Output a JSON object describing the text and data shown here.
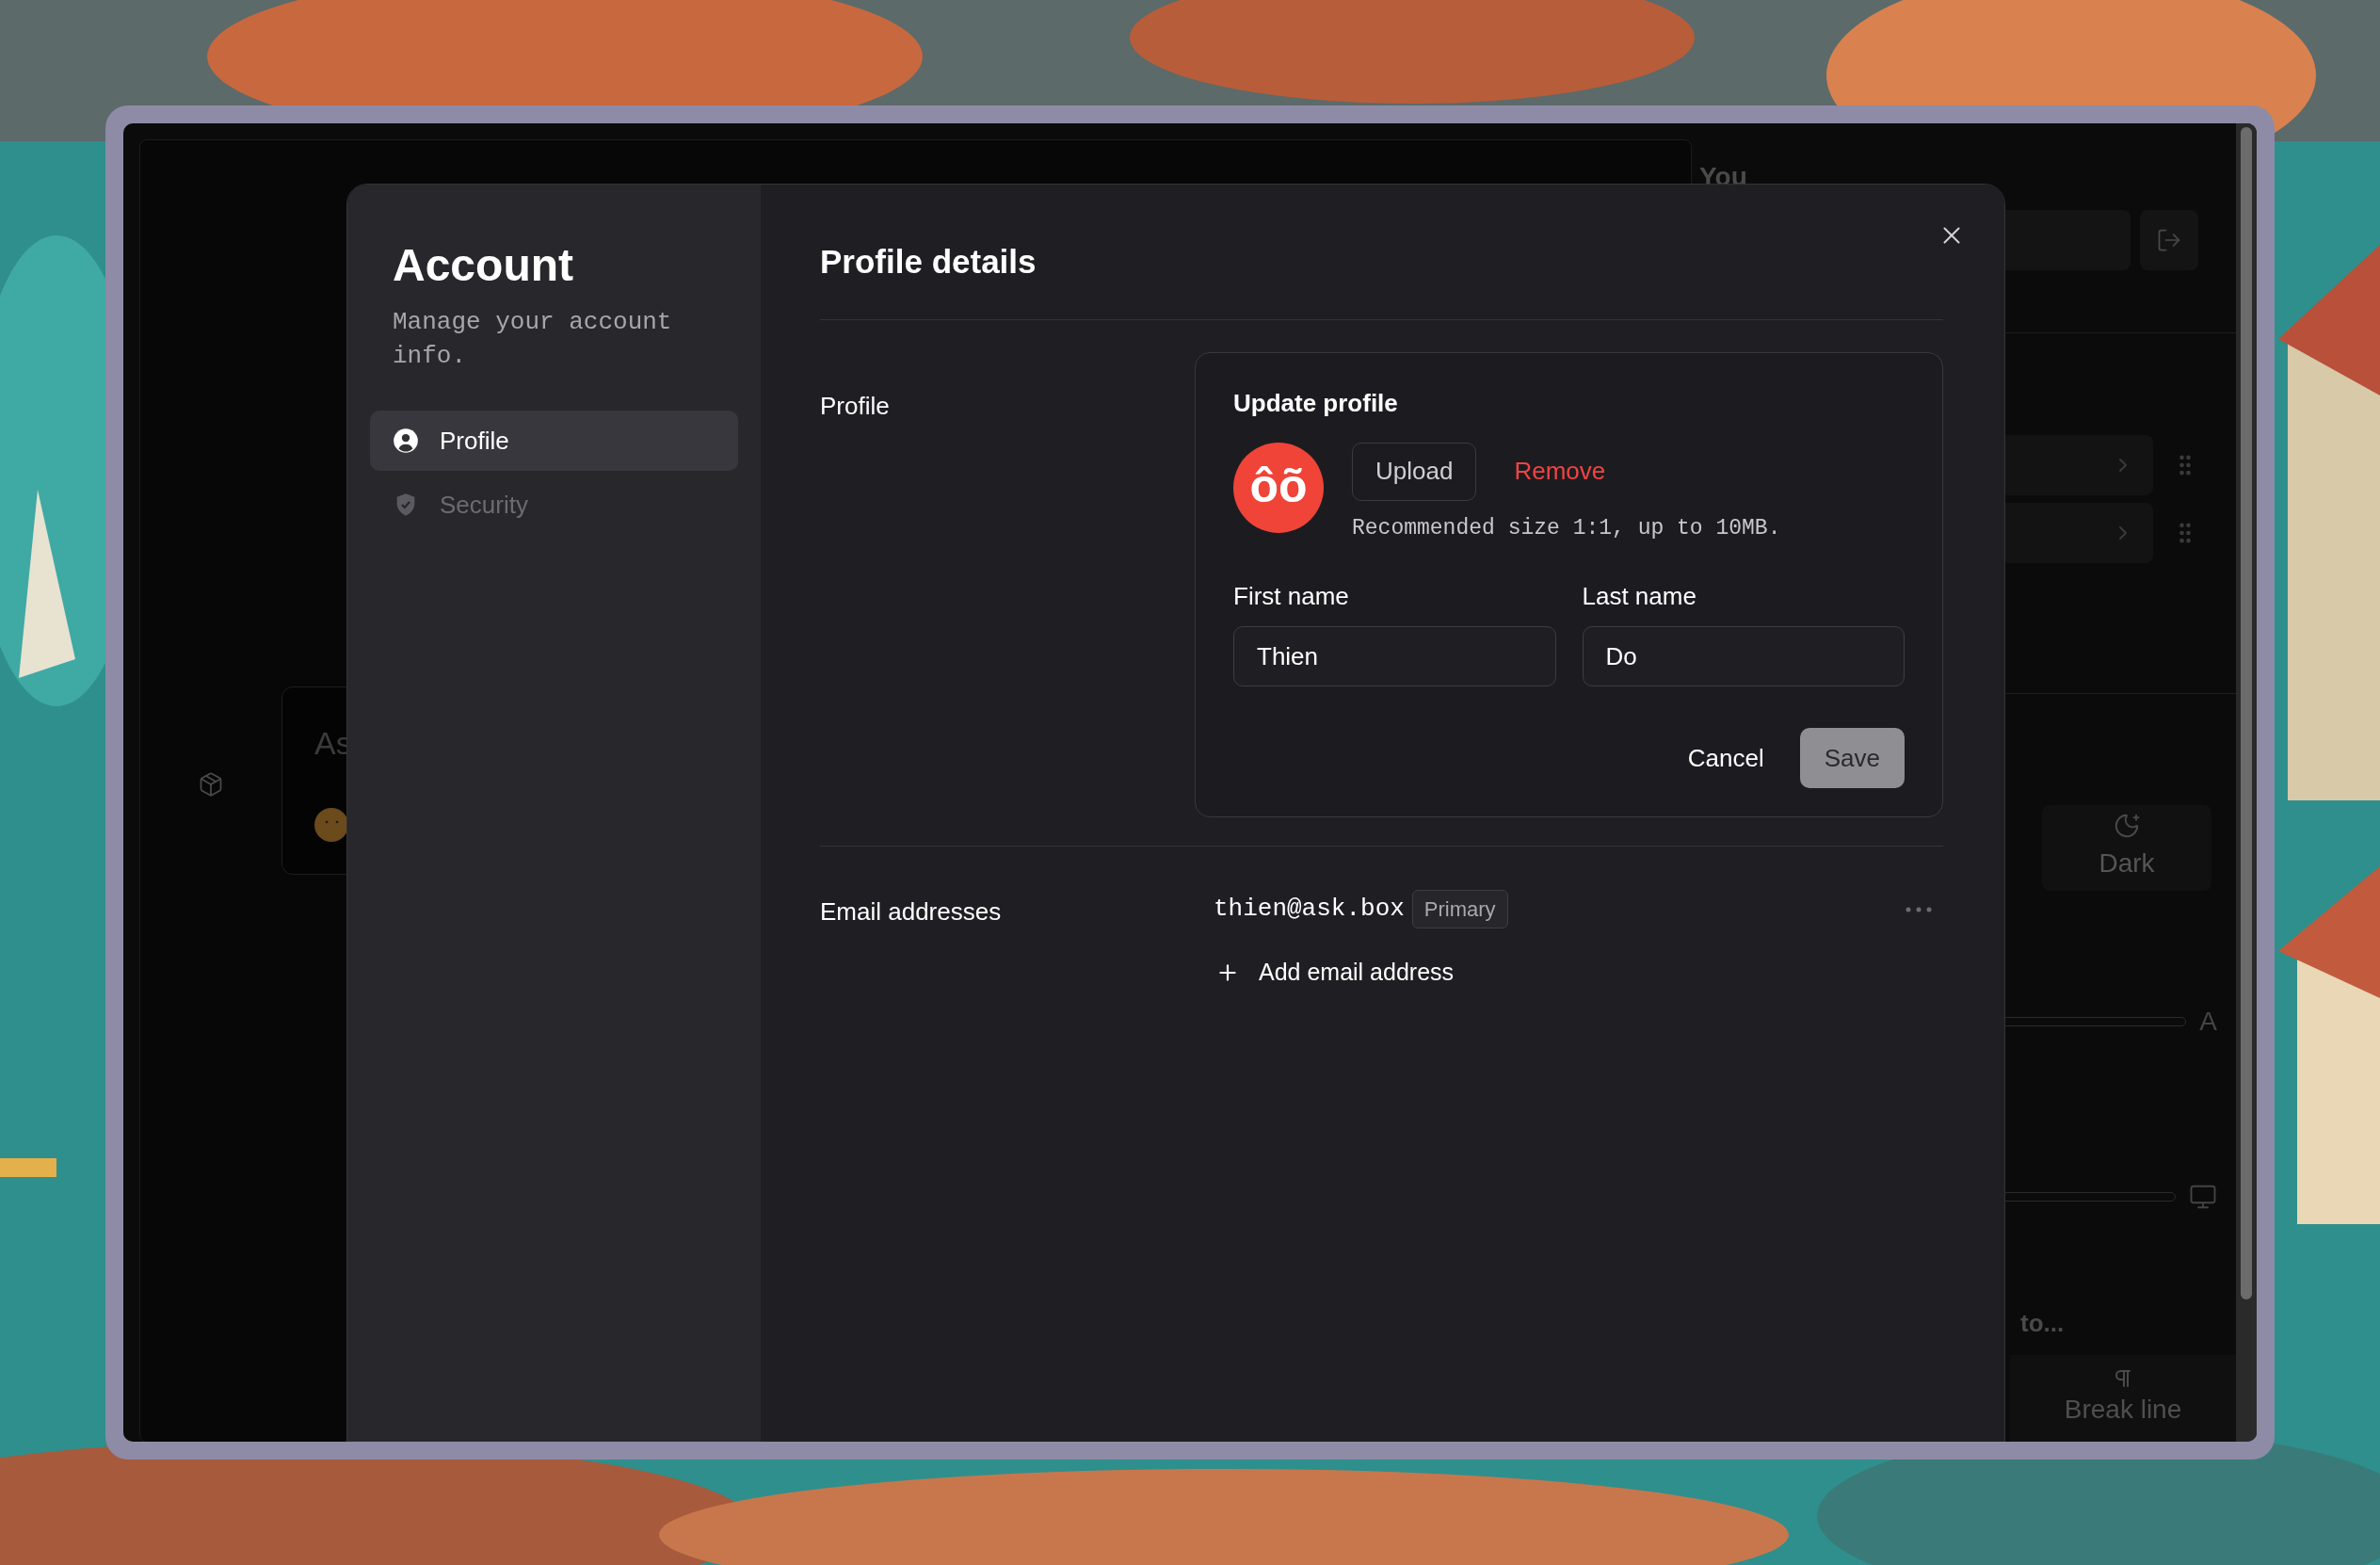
{
  "background_app": {
    "sidebar_title": "You",
    "card_title": "As",
    "theme_option": "Dark",
    "size_label": "A",
    "section_heading": "to...",
    "format_button": "Break line"
  },
  "account": {
    "title": "Account",
    "subtitle": "Manage your account info.",
    "nav": [
      {
        "label": "Profile",
        "selected": true,
        "kind": "profile"
      },
      {
        "label": "Security",
        "selected": false,
        "kind": "security"
      }
    ]
  },
  "profile_details": {
    "title": "Profile details",
    "profile_label": "Profile",
    "update_card": {
      "title": "Update profile",
      "avatar": "ôõ",
      "upload": "Upload",
      "remove": "Remove",
      "hint": "Recommended size 1:1, up to 10MB.",
      "fields": [
        {
          "label": "First name",
          "value": "Thien"
        },
        {
          "label": "Last name",
          "value": "Do"
        }
      ],
      "cancel": "Cancel",
      "save": "Save",
      "save_disabled": true
    },
    "email_label": "Email addresses",
    "emails": [
      {
        "address": "thien@ask.box",
        "badge": "Primary"
      }
    ],
    "add_email": "Add email address"
  }
}
